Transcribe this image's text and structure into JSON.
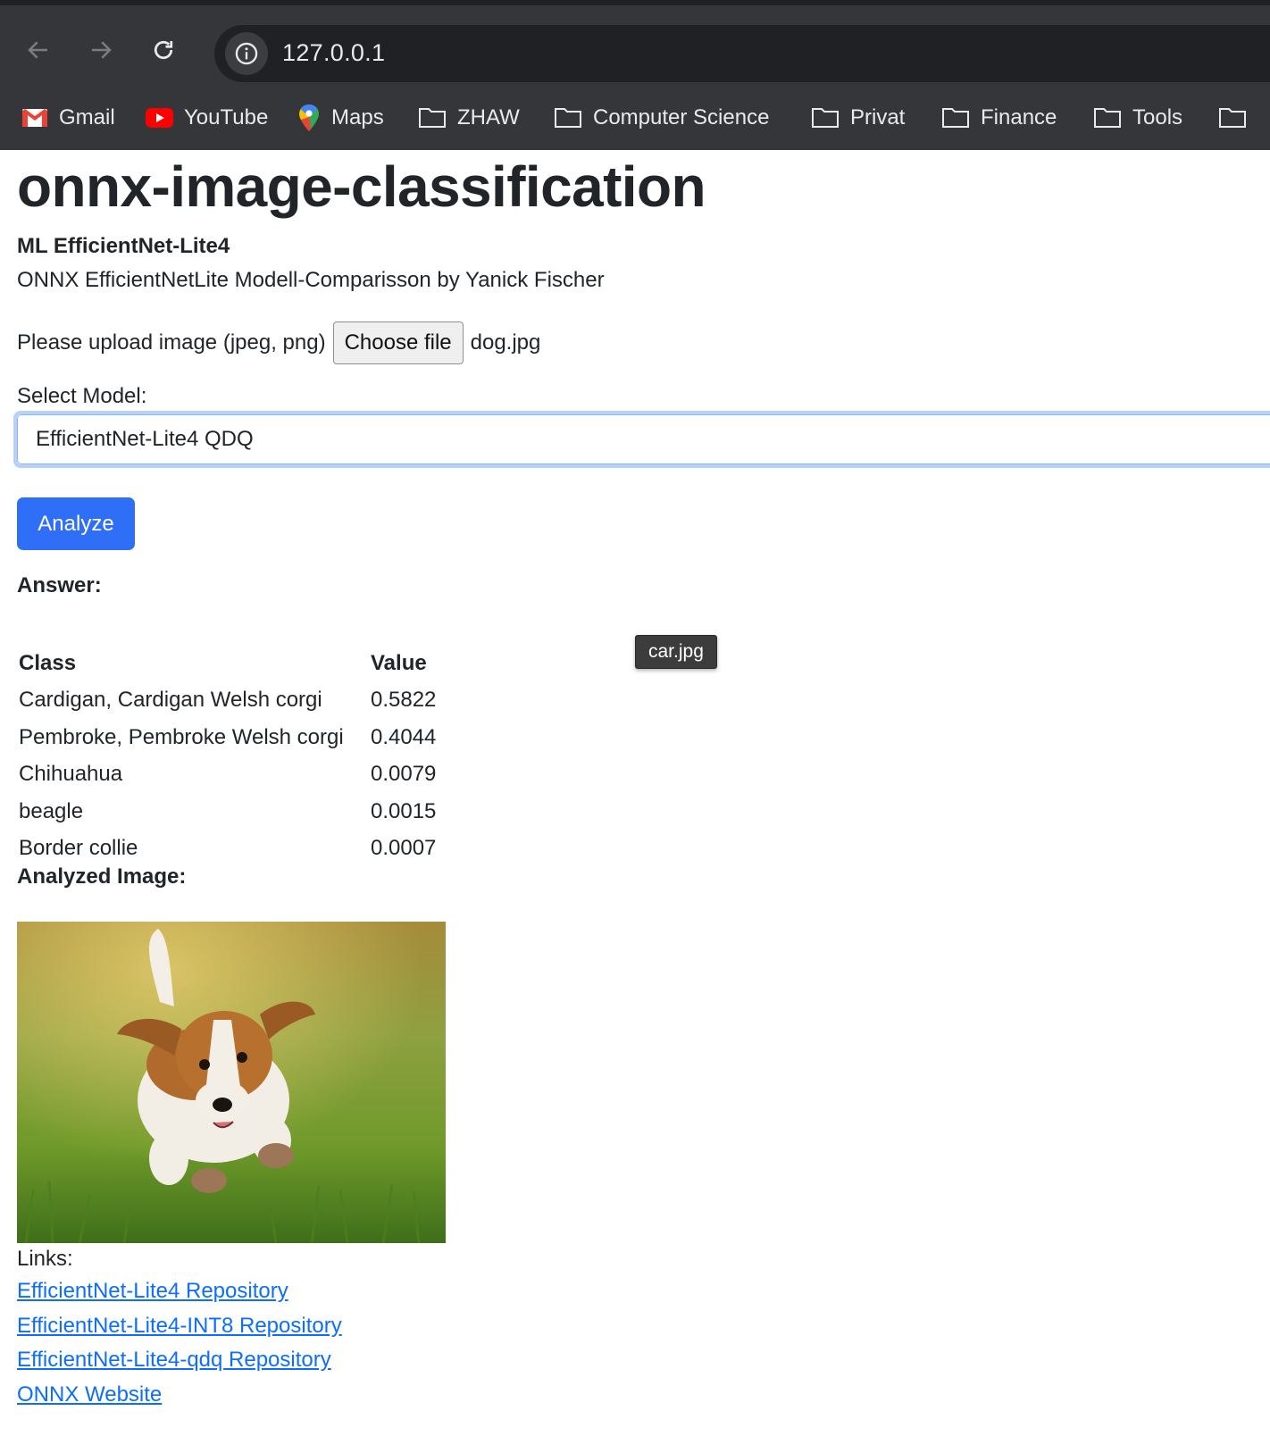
{
  "browser": {
    "url": "127.0.0.1",
    "bookmarks": [
      {
        "label": "Gmail",
        "icon": "gmail-icon"
      },
      {
        "label": "YouTube",
        "icon": "youtube-icon"
      },
      {
        "label": "Maps",
        "icon": "maps-icon"
      },
      {
        "label": "ZHAW",
        "icon": "folder-icon"
      },
      {
        "label": "Computer Science",
        "icon": "folder-icon"
      },
      {
        "label": "Privat",
        "icon": "folder-icon"
      },
      {
        "label": "Finance",
        "icon": "folder-icon"
      },
      {
        "label": "Tools",
        "icon": "folder-icon"
      }
    ]
  },
  "page": {
    "title": "onnx-image-classification",
    "model_heading": "ML EfficientNet-Lite4",
    "description": "ONNX EfficientNetLite Modell-Comparisson by Yanick Fischer",
    "upload": {
      "label": "Please upload image (jpeg, png)",
      "button_label": "Choose file",
      "file_name": "dog.jpg"
    },
    "model_select": {
      "label": "Select Model:",
      "selected": "EfficientNet-Lite4 QDQ"
    },
    "analyze_label": "Analyze",
    "answer_label": "Answer:",
    "results": {
      "headers": [
        "Class",
        "Value"
      ],
      "rows": [
        [
          "Cardigan, Cardigan Welsh corgi",
          "0.5822"
        ],
        [
          "Pembroke, Pembroke Welsh corgi",
          "0.4044"
        ],
        [
          "Chihuahua",
          "0.0079"
        ],
        [
          "beagle",
          "0.0015"
        ],
        [
          "Border collie",
          "0.0007"
        ]
      ]
    },
    "tooltip": "car.jpg",
    "analyzed_image_label": "Analyzed Image:",
    "links_label": "Links:",
    "links": [
      "EfficientNet-Lite4 Repository",
      "EfficientNet-Lite4-INT8 Repository",
      "EfficientNet-Lite4-qdq Repository",
      "ONNX Website"
    ]
  },
  "colors": {
    "chrome_bg": "#35363a",
    "omnibox_bg": "#202124",
    "primary": "#2f6ef6",
    "link": "#0d6efd",
    "focus_ring": "#b8cff8"
  }
}
